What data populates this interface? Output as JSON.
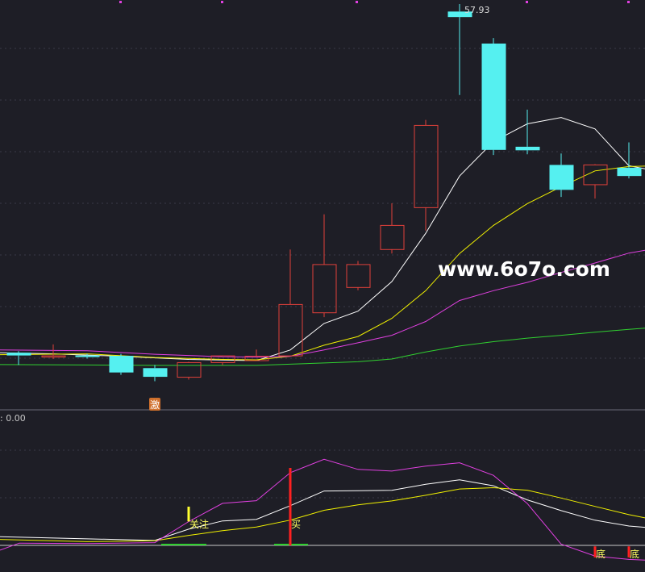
{
  "colors": {
    "background": "#1e1e26",
    "grid": "#3a3a48",
    "separator": "#6a6a78",
    "up_candle": "#e0403a",
    "down_candle": "#55f0f0",
    "ma5": "#ffffff",
    "ma10": "#f0f000",
    "ma20": "#e040e0",
    "ma60": "#30d030",
    "k_line": "#ffffff",
    "d_line": "#f0f000",
    "j_line": "#e040e0",
    "signal_red": "#ff2020",
    "signal_yellow": "#ffff30",
    "zero_line": "#c8c8c8",
    "badge_bg": "#d0702c",
    "watermark": "#ffffff"
  },
  "chart_data": [
    {
      "type": "candlestick",
      "title": "",
      "xlabel": "",
      "ylabel": "",
      "ylim": [
        0,
        1
      ],
      "grid": true,
      "high_label": "57.93",
      "candles": [
        {
          "x": 23,
          "open": 0.118,
          "close": 0.111,
          "high": 0.122,
          "low": 0.087
        },
        {
          "x": 66,
          "open": 0.108,
          "close": 0.11,
          "high": 0.139,
          "low": 0.102
        },
        {
          "x": 108,
          "open": 0.111,
          "close": 0.107,
          "high": 0.115,
          "low": 0.103
        },
        {
          "x": 150,
          "open": 0.11,
          "close": 0.068,
          "high": 0.115,
          "low": 0.062
        },
        {
          "x": 192,
          "open": 0.079,
          "close": 0.057,
          "high": 0.087,
          "low": 0.046
        },
        {
          "x": 234,
          "open": 0.056,
          "close": 0.093,
          "high": 0.095,
          "low": 0.05
        },
        {
          "x": 276,
          "open": 0.093,
          "close": 0.11,
          "high": 0.111,
          "low": 0.087
        },
        {
          "x": 318,
          "open": 0.098,
          "close": 0.109,
          "high": 0.126,
          "low": 0.098
        },
        {
          "x": 360,
          "open": 0.11,
          "close": 0.24,
          "high": 0.379,
          "low": 0.11
        },
        {
          "x": 402,
          "open": 0.219,
          "close": 0.341,
          "high": 0.468,
          "low": 0.208
        },
        {
          "x": 444,
          "open": 0.283,
          "close": 0.341,
          "high": 0.35,
          "low": 0.276
        },
        {
          "x": 486,
          "open": 0.379,
          "close": 0.44,
          "high": 0.496,
          "low": 0.369
        },
        {
          "x": 528,
          "open": 0.485,
          "close": 0.693,
          "high": 0.707,
          "low": 0.427
        },
        {
          "x": 570,
          "open": 0.981,
          "close": 0.967,
          "high": 1.0,
          "low": 0.77
        },
        {
          "x": 612,
          "open": 0.9,
          "close": 0.631,
          "high": 0.914,
          "low": 0.618
        },
        {
          "x": 654,
          "open": 0.639,
          "close": 0.63,
          "high": 0.733,
          "low": 0.62
        },
        {
          "x": 696,
          "open": 0.593,
          "close": 0.53,
          "high": 0.622,
          "low": 0.512
        },
        {
          "x": 738,
          "open": 0.543,
          "close": 0.593,
          "high": 0.595,
          "low": 0.508
        },
        {
          "x": 780,
          "open": 0.586,
          "close": 0.565,
          "high": 0.65,
          "low": 0.559
        }
      ],
      "moving_averages": [
        {
          "key": "ma5",
          "points": [
            [
              0,
              0.118
            ],
            [
              66,
              0.115
            ],
            [
              150,
              0.109
            ],
            [
              234,
              0.101
            ],
            [
              318,
              0.098
            ],
            [
              360,
              0.125
            ],
            [
              402,
              0.192
            ],
            [
              444,
              0.223
            ],
            [
              486,
              0.298
            ],
            [
              528,
              0.42
            ],
            [
              570,
              0.565
            ],
            [
              612,
              0.652
            ],
            [
              654,
              0.697
            ],
            [
              696,
              0.713
            ],
            [
              738,
              0.684
            ],
            [
              780,
              0.591
            ],
            [
              800,
              0.583
            ]
          ]
        },
        {
          "key": "ma10",
          "points": [
            [
              0,
              0.113
            ],
            [
              108,
              0.115
            ],
            [
              192,
              0.106
            ],
            [
              276,
              0.101
            ],
            [
              318,
              0.1
            ],
            [
              360,
              0.109
            ],
            [
              402,
              0.137
            ],
            [
              444,
              0.159
            ],
            [
              486,
              0.205
            ],
            [
              528,
              0.275
            ],
            [
              570,
              0.369
            ],
            [
              612,
              0.44
            ],
            [
              654,
              0.495
            ],
            [
              696,
              0.538
            ],
            [
              738,
              0.578
            ],
            [
              780,
              0.589
            ],
            [
              800,
              0.59
            ]
          ]
        },
        {
          "key": "ma20",
          "points": [
            [
              0,
              0.125
            ],
            [
              108,
              0.123
            ],
            [
              192,
              0.114
            ],
            [
              276,
              0.108
            ],
            [
              318,
              0.107
            ],
            [
              360,
              0.109
            ],
            [
              402,
              0.125
            ],
            [
              444,
              0.143
            ],
            [
              486,
              0.162
            ],
            [
              528,
              0.197
            ],
            [
              570,
              0.25
            ],
            [
              612,
              0.275
            ],
            [
              654,
              0.296
            ],
            [
              696,
              0.321
            ],
            [
              738,
              0.345
            ],
            [
              780,
              0.37
            ],
            [
              800,
              0.377
            ]
          ]
        },
        {
          "key": "ma60",
          "points": [
            [
              0,
              0.088
            ],
            [
              108,
              0.087
            ],
            [
              192,
              0.086
            ],
            [
              276,
              0.086
            ],
            [
              318,
              0.086
            ],
            [
              360,
              0.089
            ],
            [
              402,
              0.092
            ],
            [
              444,
              0.095
            ],
            [
              486,
              0.102
            ],
            [
              528,
              0.12
            ],
            [
              570,
              0.135
            ],
            [
              612,
              0.146
            ],
            [
              654,
              0.155
            ],
            [
              696,
              0.162
            ],
            [
              738,
              0.17
            ],
            [
              780,
              0.177
            ],
            [
              800,
              0.18
            ]
          ]
        }
      ],
      "annotations": [
        {
          "text": "激",
          "x": 192
        }
      ]
    },
    {
      "type": "line",
      "title": "",
      "value_label": ": 0.00",
      "ylim": [
        0,
        1
      ],
      "series": [
        {
          "key": "k_line",
          "points": [
            [
              0,
              0.112
            ],
            [
              192,
              0.064
            ],
            [
              234,
              0.209
            ],
            [
              276,
              0.316
            ],
            [
              318,
              0.336
            ],
            [
              360,
              0.512
            ],
            [
              402,
              0.702
            ],
            [
              444,
              0.706
            ],
            [
              486,
              0.711
            ],
            [
              528,
              0.789
            ],
            [
              570,
              0.847
            ],
            [
              612,
              0.77
            ],
            [
              654,
              0.588
            ],
            [
              696,
              0.449
            ],
            [
              738,
              0.325
            ],
            [
              780,
              0.25
            ],
            [
              800,
              0.233
            ]
          ]
        },
        {
          "key": "d_line",
          "points": [
            [
              0,
              0.077
            ],
            [
              108,
              0.048
            ],
            [
              192,
              0.059
            ],
            [
              234,
              0.129
            ],
            [
              276,
              0.19
            ],
            [
              318,
              0.237
            ],
            [
              360,
              0.326
            ],
            [
              402,
              0.453
            ],
            [
              444,
              0.523
            ],
            [
              486,
              0.574
            ],
            [
              528,
              0.647
            ],
            [
              570,
              0.728
            ],
            [
              612,
              0.745
            ],
            [
              654,
              0.713
            ],
            [
              696,
              0.611
            ],
            [
              738,
              0.503
            ],
            [
              780,
              0.397
            ],
            [
              800,
              0.355
            ]
          ]
        },
        {
          "key": "j_line",
          "points": [
            [
              0,
              -0.061
            ],
            [
              24,
              0.029
            ],
            [
              108,
              0.024
            ],
            [
              192,
              0.035
            ],
            [
              234,
              0.307
            ],
            [
              276,
              0.543
            ],
            [
              318,
              0.577
            ],
            [
              360,
              0.939
            ],
            [
              402,
              1.111
            ],
            [
              444,
              0.981
            ],
            [
              486,
              0.959
            ],
            [
              528,
              1.024
            ],
            [
              570,
              1.067
            ],
            [
              612,
              0.904
            ],
            [
              654,
              0.541
            ],
            [
              696,
              0.016
            ],
            [
              738,
              -0.137
            ],
            [
              780,
              -0.181
            ],
            [
              800,
              -0.19
            ]
          ]
        }
      ],
      "signals": [
        {
          "x": 234,
          "text": "关注",
          "color": "signal_yellow",
          "top_from": 0.5,
          "top_to": 0.309
        },
        {
          "x": 360,
          "text": "买",
          "color": "signal_red",
          "top_from": 1.0,
          "top_to": 0.0
        },
        {
          "x": 738,
          "text": "底",
          "color": "signal_red",
          "top_from": -0.013,
          "top_to": -0.155
        },
        {
          "x": 780,
          "text": "底",
          "color": "signal_red",
          "top_from": -0.013,
          "top_to": -0.155
        }
      ],
      "green_bars": [
        {
          "x_from": 200,
          "x_to": 256
        },
        {
          "x_from": 340,
          "x_to": 382
        }
      ]
    }
  ],
  "watermark": {
    "text": "www.6o7o.com"
  }
}
